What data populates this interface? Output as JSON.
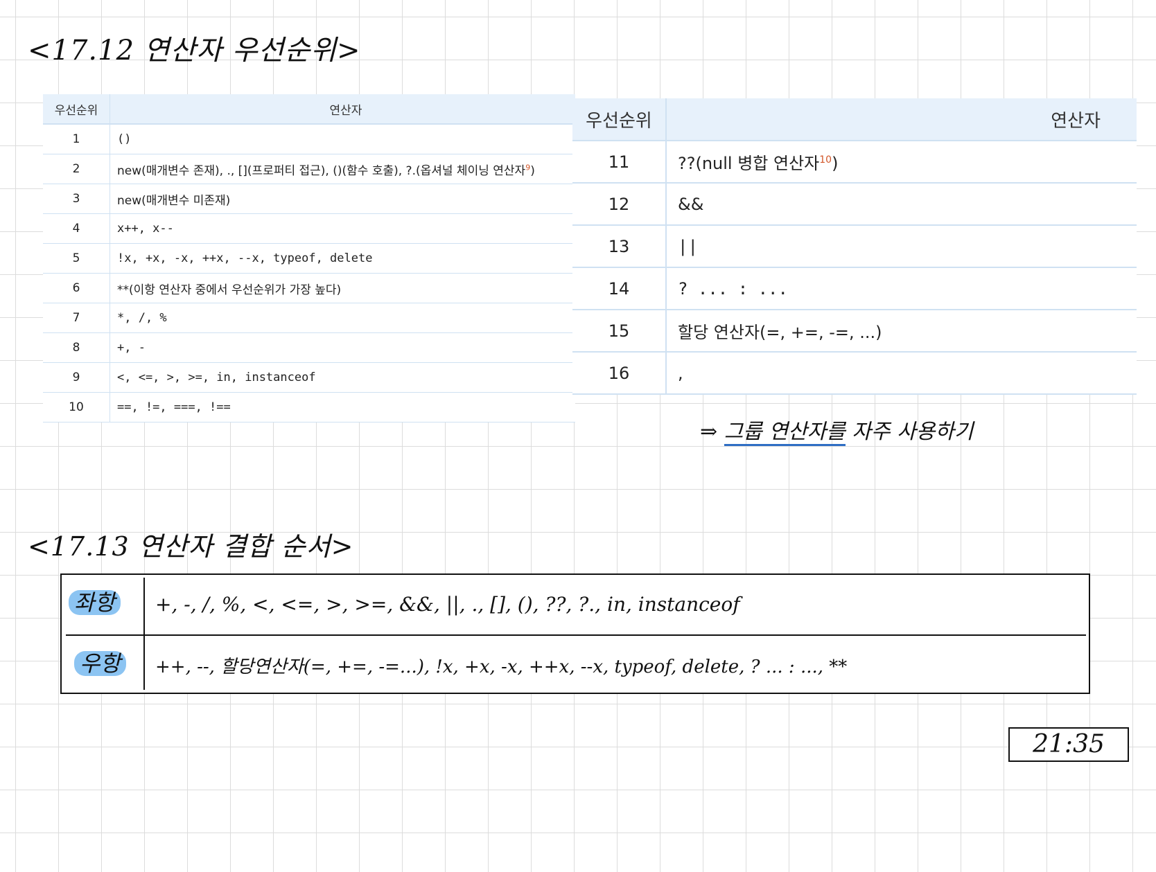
{
  "heading1": "<17.12 연산자 우선순위>",
  "heading2": "<17.13 연산자 결합 순서>",
  "table1": {
    "headers": [
      "우선순위",
      "연산자"
    ],
    "rows": [
      {
        "rank": "1",
        "op": "()"
      },
      {
        "rank": "2",
        "op": "new(매개변수 존재), ., [](프로퍼티 접근), ()(함수 호출), ?.(옵셔널 체이닝 연산자",
        "fn": "9",
        "tail": ")"
      },
      {
        "rank": "3",
        "op": "new(매개변수 미존재)"
      },
      {
        "rank": "4",
        "op": "x++, x--"
      },
      {
        "rank": "5",
        "op": "!x, +x, -x, ++x, --x, typeof, delete"
      },
      {
        "rank": "6",
        "op": "**(이항 연산자 중에서 우선순위가 가장 높다)"
      },
      {
        "rank": "7",
        "op": "*, /, %"
      },
      {
        "rank": "8",
        "op": "+, -"
      },
      {
        "rank": "9",
        "op": "<, <=, >, >=, in, instanceof"
      },
      {
        "rank": "10",
        "op": "==, !=, ===, !=="
      }
    ]
  },
  "table2": {
    "headers": [
      "우선순위",
      "연산자"
    ],
    "rows": [
      {
        "rank": "11",
        "op": "??(null 병합 연산자",
        "fn": "10",
        "tail": ")"
      },
      {
        "rank": "12",
        "op": "&&"
      },
      {
        "rank": "13",
        "op": "||"
      },
      {
        "rank": "14",
        "op": "? ... : ..."
      },
      {
        "rank": "15",
        "op": "할당 연산자(=, +=, -=, ...)"
      },
      {
        "rank": "16",
        "op": ","
      }
    ]
  },
  "note": {
    "arrow": "⇒",
    "underlined": "그룹 연산자를",
    "rest": " 자주 사용하기"
  },
  "assoc": {
    "left_label": "좌항",
    "left_ops": "+, -, /, %, <, <=, >, >=, &&, ||, ., [], (), ??, ?., in, instanceof",
    "right_label": "우항",
    "right_ops": "++, --, 할당연산자(=, +=, -=...), !x, +x, -x, ++x, --x, typeof, delete, ? ... : ..., **"
  },
  "time": "21:35",
  "colors": {
    "header_bg": "#e7f1fb",
    "rule": "#cfe1f2",
    "footnote": "#d2572a",
    "highlight": "#8cc4f2",
    "underline": "#2f6ec4"
  }
}
